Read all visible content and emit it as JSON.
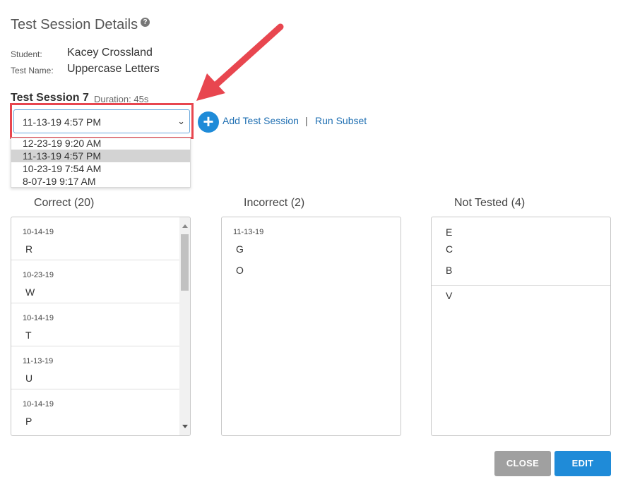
{
  "header": {
    "title": "Test Session Details",
    "help_icon": "help-circle-icon"
  },
  "student": {
    "label": "Student:",
    "value": "Kacey Crossland"
  },
  "test_name": {
    "label": "Test Name:",
    "value": "Uppercase Letters"
  },
  "session": {
    "heading": "Test Session 7",
    "duration": "Duration: 45s"
  },
  "session_select": {
    "value": "11-13-19 4:57 PM",
    "options": [
      "12-23-19 9:20 AM",
      "11-13-19 4:57 PM",
      "10-23-19 7:54 AM",
      "8-07-19 9:17 AM"
    ]
  },
  "actions": {
    "add_session": "Add Test Session",
    "separator": "|",
    "run_subset": "Run Subset"
  },
  "correct": {
    "title": "Correct (20)",
    "groups": [
      {
        "date": "10-14-19",
        "items": [
          "R"
        ]
      },
      {
        "date": "10-23-19",
        "items": [
          "W"
        ]
      },
      {
        "date": "10-14-19",
        "items": [
          "T"
        ]
      },
      {
        "date": "11-13-19",
        "items": [
          "U"
        ]
      },
      {
        "date": "10-14-19",
        "items": [
          "P"
        ]
      }
    ]
  },
  "incorrect": {
    "title": "Incorrect (2)",
    "groups": [
      {
        "date": "11-13-19",
        "items": [
          "G",
          "O"
        ]
      }
    ]
  },
  "not_tested": {
    "title": "Not Tested (4)",
    "groups": [
      {
        "items": [
          "E",
          "C",
          "B"
        ]
      },
      {
        "items": [
          "V"
        ]
      }
    ]
  },
  "buttons": {
    "close": "CLOSE",
    "edit": "EDIT"
  },
  "colors": {
    "accent": "#1f8bd8",
    "highlight": "#e8464f",
    "close_button": "#a0a0a0"
  }
}
